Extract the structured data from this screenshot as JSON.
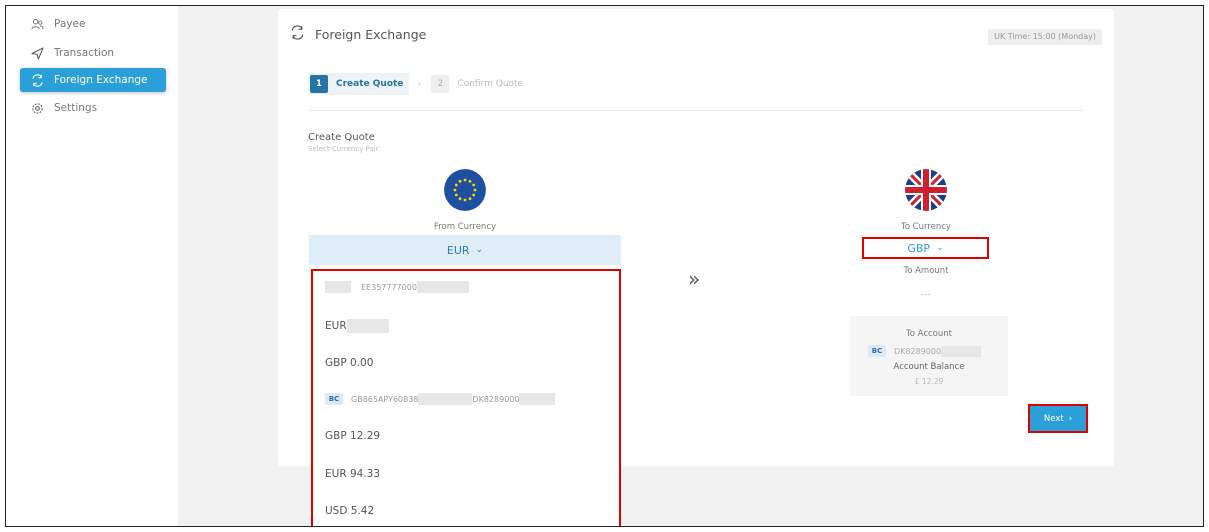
{
  "sidebar": {
    "items": [
      {
        "label": "Payee",
        "icon": "users-icon",
        "active": false
      },
      {
        "label": "Transaction",
        "icon": "send-icon",
        "active": false
      },
      {
        "label": "Foreign Exchange",
        "icon": "exchange-icon",
        "active": true
      },
      {
        "label": "Settings",
        "icon": "gear-icon",
        "active": false
      }
    ]
  },
  "header": {
    "title": "Foreign Exchange",
    "uk_time": "UK Time: 15:00 (Monday)"
  },
  "steps": [
    {
      "number": "1",
      "label": "Create Quote",
      "active": true
    },
    {
      "number": "2",
      "label": "Confirm Quote",
      "active": false
    }
  ],
  "section": {
    "title": "Create Quote",
    "subtitle": "Select Currency Pair"
  },
  "from": {
    "label": "From Currency",
    "selected": "EUR",
    "flag": "eu-flag-icon"
  },
  "dropdown": {
    "account1": "EE357777000",
    "options": [
      {
        "label": "EUR"
      },
      {
        "label": "GBP 0.00"
      },
      {
        "label": "GBP 12.29"
      },
      {
        "label": "EUR 94.33"
      },
      {
        "label": "USD 5.42"
      }
    ],
    "account2_badge": "BC",
    "account2_iban": "GB865APY60838",
    "account2_extra": "DK8289000"
  },
  "to": {
    "label": "To Currency",
    "selected": "GBP",
    "flag": "uk-flag-icon",
    "amount_label": "To Amount",
    "amount_value": "---",
    "account_label": "To Account",
    "account_badge": "BC",
    "account_number": "DK8289000",
    "balance_label": "Account Balance",
    "balance_value": "£ 12.29"
  },
  "next_button": "Next",
  "colors": {
    "accent": "#2a9fd8",
    "highlight": "#e00000",
    "step_active": "#2673a6"
  }
}
